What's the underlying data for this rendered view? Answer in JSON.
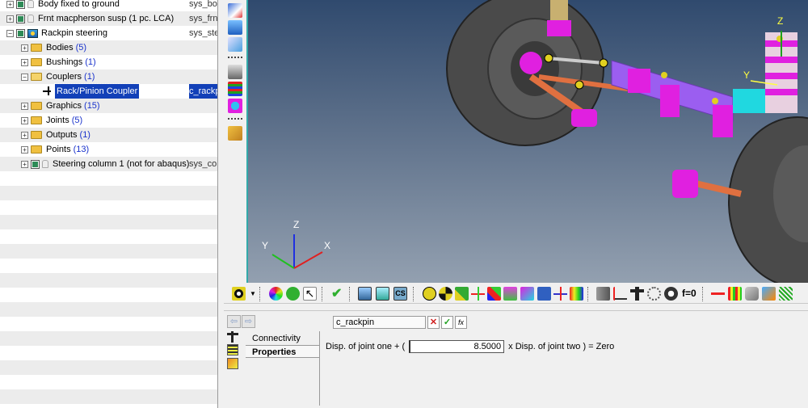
{
  "model_browser": {
    "rows": [
      {
        "label": "Body fixed to ground",
        "col2": "sys_bo"
      },
      {
        "label": "Frnt macpherson susp (1 pc. LCA)",
        "col2": "sys_frn"
      },
      {
        "label": "Rackpin steering",
        "col2": "sys_ste"
      },
      {
        "label": "Bodies",
        "count": "(5)"
      },
      {
        "label": "Bushings",
        "count": "(1)"
      },
      {
        "label": "Couplers",
        "count": "(1)"
      },
      {
        "label": "Rack/Pinion Coupler",
        "col2": "c_rackp"
      },
      {
        "label": "Graphics",
        "count": "(15)"
      },
      {
        "label": "Joints",
        "count": "(5)"
      },
      {
        "label": "Outputs",
        "count": "(1)"
      },
      {
        "label": "Points",
        "count": "(13)"
      },
      {
        "label": "Steering column 1  (not for abaqus)",
        "col2": "sys_co"
      }
    ]
  },
  "viewport": {
    "axis_z": "Z",
    "axis_y": "Y",
    "axis_x": "X",
    "model_axis_z": "Z",
    "model_axis_y": "Y"
  },
  "toolbar": {
    "f0_label": "f=0"
  },
  "panel": {
    "entity_name": "c_rackpin",
    "cancel_glyph": "✕",
    "accept_glyph": "✓",
    "fx_glyph": "fx",
    "tabs": [
      "Connectivity",
      "Properties"
    ],
    "formula_prefix": "Disp. of joint one + (",
    "ratio_value": "8.5000",
    "formula_suffix": "x Disp. of joint two ) = Zero"
  },
  "colors": {
    "selection": "#1240b8",
    "viewport_top": "#304a6e",
    "viewport_bottom": "#93a0b0",
    "tire": "#4a4a4a",
    "magenta_part": "#e020e0",
    "cyan_part": "#20d8e0",
    "purple_rack": "#9b5ef0",
    "orange_link": "#e07040"
  }
}
